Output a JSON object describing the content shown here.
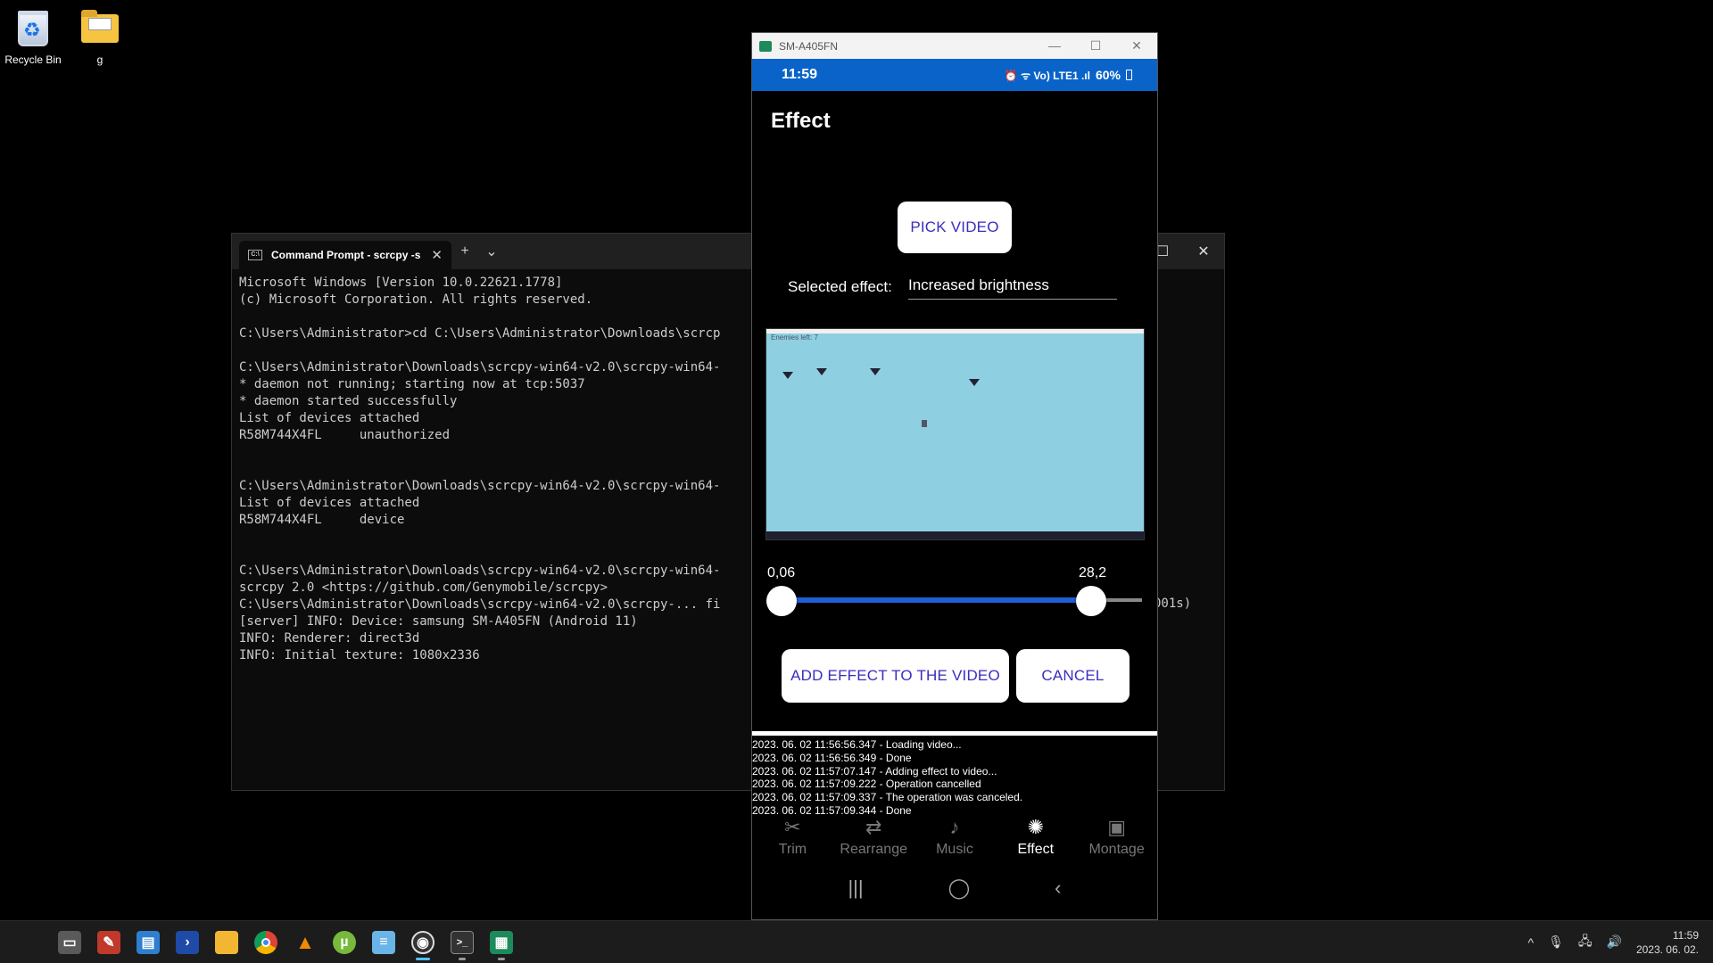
{
  "desktop": {
    "icons": [
      {
        "label": "Recycle Bin"
      },
      {
        "label": "g"
      }
    ]
  },
  "terminal": {
    "tab_title": "Command Prompt - scrcpy -s",
    "new_tab": "+",
    "tab_menu": "⌄",
    "controls": {
      "maximize": "☐",
      "close": "✕"
    },
    "lines": [
      "Microsoft Windows [Version 10.0.22621.1778]",
      "(c) Microsoft Corporation. All rights reserved.",
      "",
      "C:\\Users\\Administrator>cd C:\\Users\\Administrator\\Downloads\\scrcp",
      "",
      "C:\\Users\\Administrator\\Downloads\\scrcpy-win64-v2.0\\scrcpy-win64-",
      "* daemon not running; starting now at tcp:5037",
      "* daemon started successfully",
      "List of devices attached",
      "R58M744X4FL     unauthorized",
      "",
      "",
      "C:\\Users\\Administrator\\Downloads\\scrcpy-win64-v2.0\\scrcpy-win64-",
      "List of devices attached",
      "R58M744X4FL     device",
      "",
      "",
      "C:\\Users\\Administrator\\Downloads\\scrcpy-win64-v2.0\\scrcpy-win64-",
      "scrcpy 2.0 <https://github.com/Genymobile/scrcpy>",
      "C:\\Users\\Administrator\\Downloads\\scrcpy-win64-v2.0\\scrcpy-... fi",
      "[server] INFO: Device: samsung SM-A405FN (Android 11)",
      "INFO: Renderer: direct3d",
      "INFO: Initial texture: 1080x2336"
    ],
    "overflow_text": "001s)"
  },
  "phone": {
    "window_title": "SM-A405FN",
    "window_controls": {
      "minimize": "—",
      "maximize": "☐",
      "close": "✕"
    },
    "status": {
      "time": "11:59",
      "icons": "⏰ ᯤ Vo) LTE1 .ıl",
      "battery": "60%"
    },
    "screen_title": "Effect",
    "pick_video": "PICK VIDEO",
    "selected_effect_label": "Selected effect:",
    "selected_effect_value": "Increased brightness",
    "preview_caption": "Enemies left: 7",
    "range": {
      "min_label": "0,06",
      "max_label": "28,2",
      "start_fraction": 0.0,
      "end_fraction": 0.86
    },
    "add_effect": "ADD EFFECT TO THE VIDEO",
    "cancel": "CANCEL",
    "log": [
      "2023. 06. 02 11:56:56.347 - Loading video...",
      "2023. 06. 02 11:56:56.349 - Done",
      "2023. 06. 02 11:57:07.147 - Adding effect to video...",
      "2023. 06. 02 11:57:09.222 - Operation cancelled",
      "2023. 06. 02 11:57:09.337 - The operation was canceled.",
      "2023. 06. 02 11:57:09.344 - Done"
    ],
    "nav": [
      {
        "label": "Trim",
        "icon": "scissors-icon"
      },
      {
        "label": "Rearrange",
        "icon": "rearrange-icon"
      },
      {
        "label": "Music",
        "icon": "music-icon"
      },
      {
        "label": "Effect",
        "icon": "effect-icon"
      },
      {
        "label": "Montage",
        "icon": "montage-icon"
      }
    ],
    "sys_nav": {
      "recents": "|||",
      "home": "◯",
      "back": "‹"
    }
  },
  "taskbar": {
    "clock_time": "11:59",
    "clock_date": "2023. 06. 02.",
    "tray": {
      "chevron": "^",
      "mic": "🎙",
      "network": "🖧",
      "volume": "🔊"
    }
  },
  "colors": {
    "status_bar": "#0a63c9",
    "button_text": "#3a2dbd",
    "slider_fill": "#1f5fd6",
    "preview_bg": "#8fcfe2"
  }
}
